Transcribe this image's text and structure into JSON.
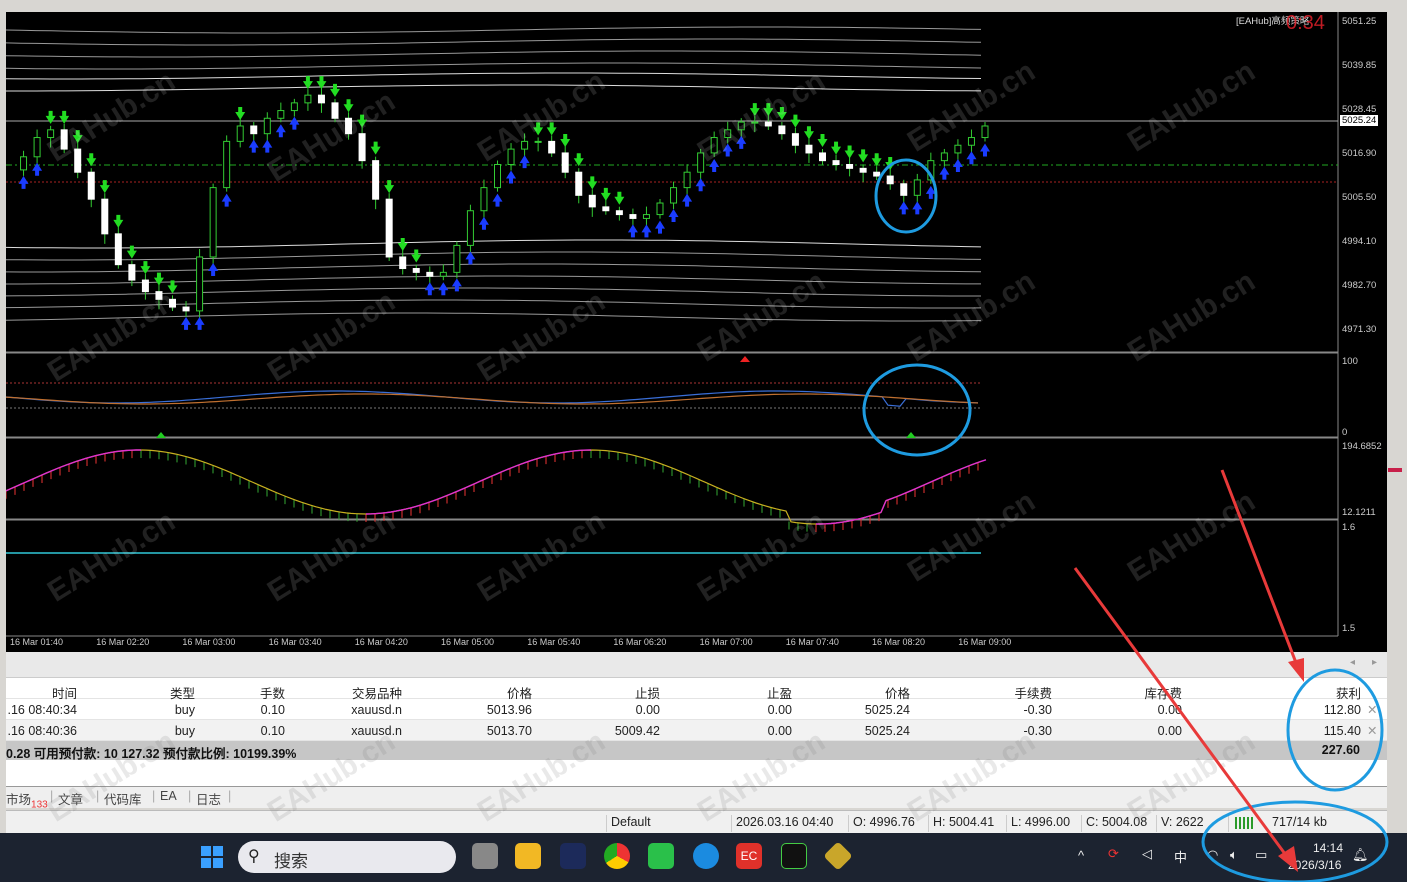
{
  "chart": {
    "ea_title": "[EAHub]高频策略",
    "countdown": "0:34",
    "current_price": "5025.24",
    "price_axis": [
      "5051.25",
      "5039.85",
      "5028.45",
      "5016.90",
      "5005.50",
      "4994.10",
      "4982.70",
      "4971.30"
    ],
    "ind1_axis": [
      "100",
      "0"
    ],
    "ind2_axis": [
      "194.6852",
      "12.1211"
    ],
    "ind3_axis": [
      "1.6",
      "1.5"
    ],
    "time_axis": [
      "16 Mar 01:40",
      "16 Mar 02:20",
      "16 Mar 03:00",
      "16 Mar 03:40",
      "16 Mar 04:20",
      "16 Mar 05:00",
      "16 Mar 05:40",
      "16 Mar 06:20",
      "16 Mar 07:00",
      "16 Mar 07:40",
      "16 Mar 08:20",
      "16 Mar 09:00"
    ],
    "price_range": [
      4971.3,
      5051.25
    ],
    "closes": [
      5012.6,
      5016,
      5021,
      5023,
      5018,
      5012,
      5005,
      4996,
      4988,
      4984,
      4981,
      4979,
      4977,
      4976,
      4990,
      5008,
      5020,
      5024,
      5022,
      5026,
      5028,
      5030,
      5032,
      5030,
      5026,
      5022,
      5015,
      5005,
      4990,
      4987,
      4986,
      4985,
      4986,
      4993,
      5002,
      5008,
      5014,
      5018,
      5020,
      5020,
      5017,
      5012,
      5006,
      5003,
      5002,
      5001,
      5000,
      5001,
      5004,
      5008,
      5012,
      5017,
      5021,
      5023,
      5025,
      5025,
      5024,
      5022,
      5019,
      5017,
      5015,
      5014,
      5013,
      5012,
      5011,
      5009,
      5006,
      5010,
      5015,
      5017,
      5019,
      5021,
      5024
    ]
  },
  "positions": {
    "headers": [
      "时间",
      "类型",
      "手数",
      "交易品种",
      "价格",
      "止损",
      "止盈",
      "价格",
      "手续费",
      "库存费",
      "获利"
    ],
    "rows": [
      [
        ".16 08:40:34",
        "buy",
        "0.10",
        "xauusd.n",
        "5013.96",
        "0.00",
        "0.00",
        "5025.24",
        "-0.30",
        "0.00",
        "112.80"
      ],
      [
        ".16 08:40:36",
        "buy",
        "0.10",
        "xauusd.n",
        "5013.70",
        "5009.42",
        "0.00",
        "5025.24",
        "-0.30",
        "0.00",
        "115.40"
      ]
    ],
    "summary": "0.28  可用预付款: 10 127.32  预付款比例: 10199.39%",
    "total_profit": "227.60",
    "close_icon": "close-icon"
  },
  "tabs": [
    {
      "label": "市场",
      "badge": "133"
    },
    {
      "label": "文章"
    },
    {
      "label": "代码库"
    },
    {
      "label": "EA"
    },
    {
      "label": "日志"
    }
  ],
  "status": {
    "profile": "Default",
    "datetime": "2026.03.16 04:40",
    "open": "O: 4996.76",
    "high": "H: 5004.41",
    "low": "L: 4996.00",
    "close": "C: 5004.08",
    "volume": "V: 2622",
    "traffic": "717/14 kb"
  },
  "taskbar": {
    "search_placeholder": "搜索",
    "ime": "中",
    "time": "14:14",
    "date": "2026/3/16"
  },
  "watermark": "EAHub.cn",
  "colors": {
    "bull_arrow": "#1a3cff",
    "bear_arrow": "#22dd22",
    "annotation_circle": "#1e9be0",
    "annotation_arrow": "#e83a3a"
  }
}
